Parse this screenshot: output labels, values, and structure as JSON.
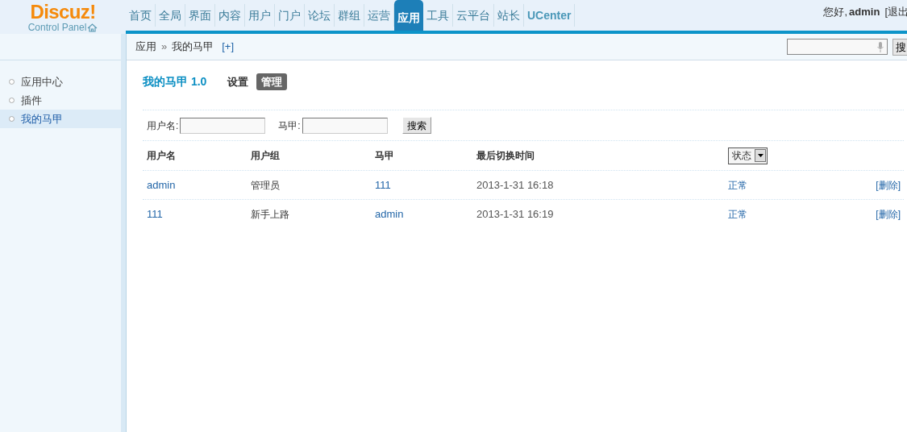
{
  "logo": {
    "name": "Discuz!",
    "subtitle": "Control Panel"
  },
  "nav": [
    {
      "label": "首页",
      "selected": false
    },
    {
      "label": "全局",
      "selected": false
    },
    {
      "label": "界面",
      "selected": false
    },
    {
      "label": "内容",
      "selected": false
    },
    {
      "label": "用户",
      "selected": false
    },
    {
      "label": "门户",
      "selected": false
    },
    {
      "label": "论坛",
      "selected": false
    },
    {
      "label": "群组",
      "selected": false
    },
    {
      "label": "运营",
      "selected": false
    },
    {
      "label": "应用",
      "selected": true
    },
    {
      "label": "工具",
      "selected": false
    },
    {
      "label": "云平台",
      "selected": false
    },
    {
      "label": "站长",
      "selected": false
    },
    {
      "label": "UCenter",
      "selected": false
    }
  ],
  "user": {
    "greeting": "您好,",
    "name": "admin",
    "logout": "[退出"
  },
  "breadcrumb": {
    "parent": "应用",
    "separator": "»",
    "current": "我的马甲",
    "add": "[+]"
  },
  "top_search": {
    "button": "搜"
  },
  "sidebar": {
    "items": [
      {
        "label": "应用中心",
        "selected": false
      },
      {
        "label": "插件",
        "selected": false
      },
      {
        "label": "我的马甲",
        "selected": true
      }
    ]
  },
  "page": {
    "title": "我的马甲 1.0",
    "tabs": [
      {
        "label": "设置",
        "selected": false
      },
      {
        "label": "管理",
        "selected": true
      }
    ]
  },
  "filter": {
    "fields": [
      {
        "label": "用户名:"
      },
      {
        "label": "马甲:"
      }
    ],
    "button": "搜索"
  },
  "table": {
    "columns": [
      "用户名",
      "用户组",
      "马甲",
      "最后切换时间"
    ],
    "status_select": "状态",
    "rows": [
      {
        "user": "admin",
        "group": "管理员",
        "alias": "111",
        "time": "2013-1-31 16:18",
        "status": "正常",
        "action": "[删除]"
      },
      {
        "user": "111",
        "group": "新手上路",
        "alias": "admin",
        "time": "2013-1-31 16:19",
        "status": "正常",
        "action": "[删除]"
      }
    ]
  }
}
